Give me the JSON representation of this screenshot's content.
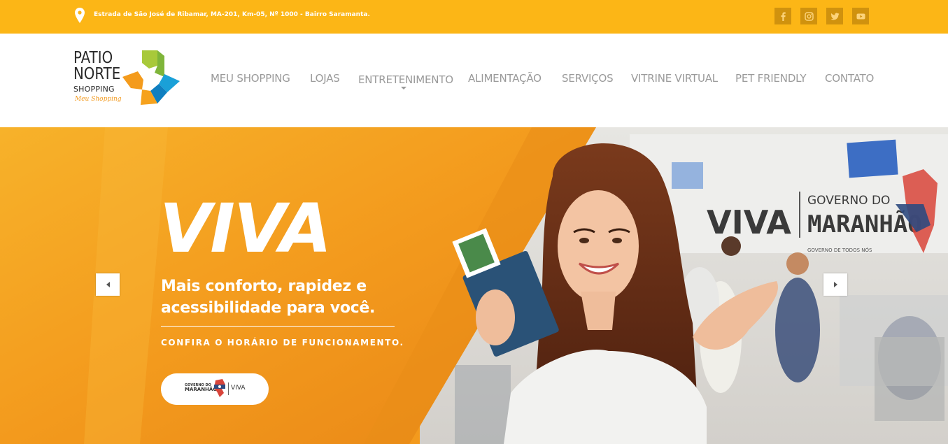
{
  "topbar": {
    "address": "Estrada de São José de Ribamar, MA-201, Km-05, Nº 1000 - Bairro Saramanta.",
    "social": [
      {
        "icon": "facebook-icon"
      },
      {
        "icon": "instagram-icon"
      },
      {
        "icon": "twitter-icon"
      },
      {
        "icon": "youtube-icon"
      }
    ]
  },
  "logo": {
    "line1": "PATIO",
    "line2": "NORTE",
    "line3": "SHOPPING",
    "tagline": "Meu Shopping"
  },
  "nav": {
    "items": [
      {
        "label": "MEU SHOPPING"
      },
      {
        "label": "LOJAS"
      },
      {
        "label": "ENTRETENIMENTO"
      },
      {
        "label": "ALIMENTAÇÃO"
      },
      {
        "label": "SERVIÇOS"
      },
      {
        "label": "VITRINE VIRTUAL"
      },
      {
        "label": "PET FRIENDLY"
      },
      {
        "label": "CONTATO"
      }
    ]
  },
  "hero": {
    "headline": "VIVA",
    "subtitle_line1": "Mais conforto, rapidez e",
    "subtitle_line2": "acessibilidade para você.",
    "cta": "CONFIRA O HORÁRIO DE FUNCIONAMENTO.",
    "pill": {
      "gov_line1": "GOVERNO DO",
      "gov_line2": "MARANHÃO",
      "viva": "VIVA"
    },
    "sign_viva": "VIVA",
    "sign_gov1": "GOVERNO DO",
    "sign_gov2": "MARANHÃO",
    "sign_gov3": "GOVERNO DE TODOS NÓS"
  },
  "colors": {
    "topbar": "#fcb616",
    "hero_orange": "#f39a1d",
    "nav_text": "#9a9a9a"
  }
}
